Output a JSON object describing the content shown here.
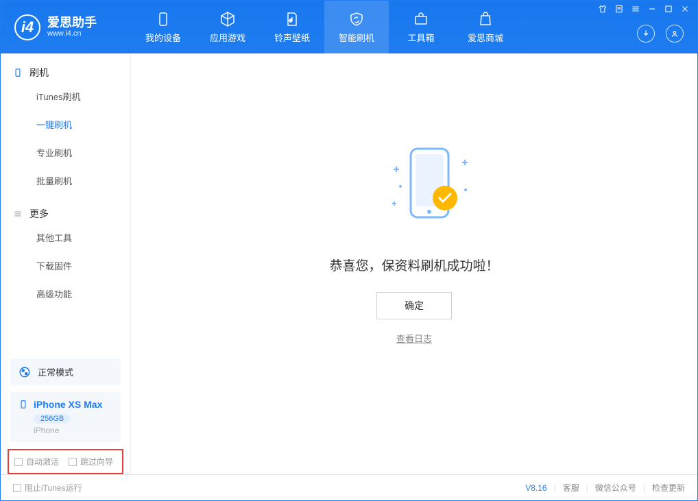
{
  "logo": {
    "title": "爱思助手",
    "sub": "www.i4.cn"
  },
  "nav": [
    {
      "label": "我的设备"
    },
    {
      "label": "应用游戏"
    },
    {
      "label": "铃声壁纸"
    },
    {
      "label": "智能刷机"
    },
    {
      "label": "工具箱"
    },
    {
      "label": "爱思商城"
    }
  ],
  "sidebar": {
    "section1": "刷机",
    "items1": [
      "iTunes刷机",
      "一键刷机",
      "专业刷机",
      "批量刷机"
    ],
    "section2": "更多",
    "items2": [
      "其他工具",
      "下载固件",
      "高级功能"
    ]
  },
  "mode": {
    "label": "正常模式"
  },
  "device": {
    "name": "iPhone XS Max",
    "badge": "256GB",
    "sub": "iPhone"
  },
  "checks": {
    "auto_activate": "自动激活",
    "skip_guide": "跳过向导"
  },
  "main": {
    "success_text": "恭喜您，保资料刷机成功啦！",
    "ok_button": "确定",
    "view_log": "查看日志"
  },
  "footer": {
    "block_itunes": "阻止iTunes运行",
    "version": "V8.16",
    "links": [
      "客服",
      "微信公众号",
      "检查更新"
    ]
  }
}
